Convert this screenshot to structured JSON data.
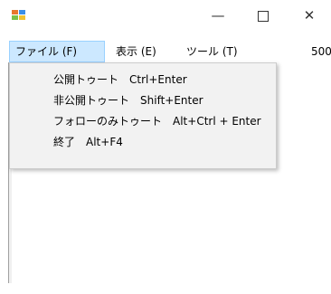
{
  "window": {
    "minimize": "—",
    "close": "✕",
    "icon": "app-icon"
  },
  "menubar": {
    "items": [
      {
        "label": "ファイル (F)"
      },
      {
        "label": "表示 (E)"
      },
      {
        "label": "ツール (T)"
      },
      {
        "label": "500"
      }
    ]
  },
  "file_menu": {
    "items": [
      {
        "label": "公開トゥート",
        "shortcut": "Ctrl+Enter"
      },
      {
        "label": "非公開トゥート",
        "shortcut": "Shift+Enter"
      },
      {
        "label": "フォローのみトゥート",
        "shortcut": "Alt+Ctrl + Enter"
      },
      {
        "label": "終了",
        "shortcut": "Alt+F4"
      }
    ]
  },
  "colors": {
    "menu_highlight": "#cce8ff",
    "menu_highlight_border": "#99d1ff",
    "dropdown_bg": "#f2f2f2"
  }
}
